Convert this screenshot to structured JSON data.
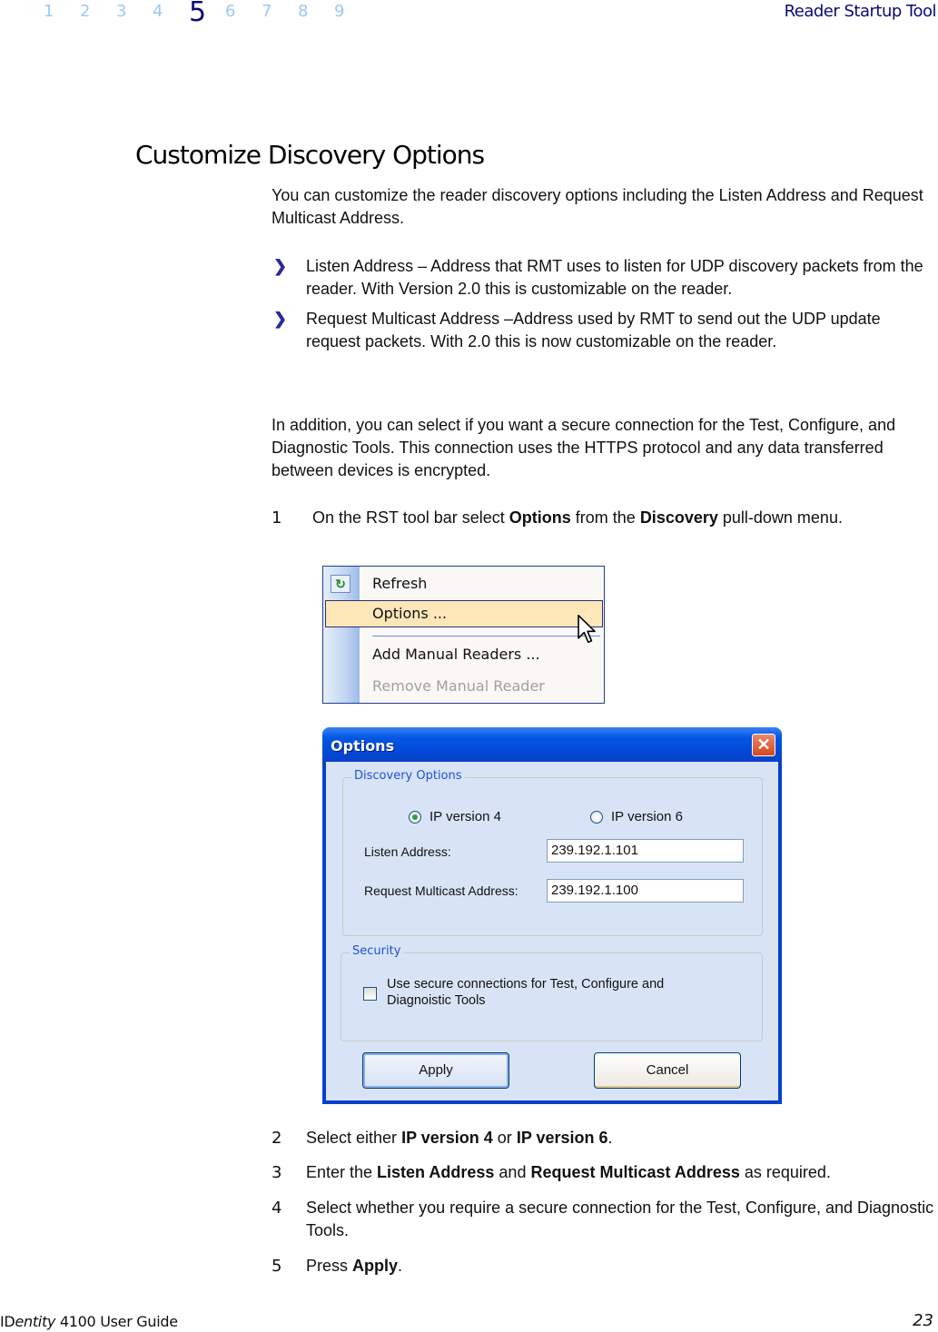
{
  "header": {
    "chapters": [
      "1",
      "2",
      "3",
      "4",
      "5",
      "6",
      "7",
      "8",
      "9"
    ],
    "current_chapter": "5",
    "section_name": "Reader Startup Tool"
  },
  "section_title": "Customize Discovery Options",
  "intro": "You can customize the reader discovery options including the Listen Address and Request Multicast Address.",
  "bullets": [
    "Listen Address – Address that RMT uses to listen for UDP discovery packets from the reader. With Version 2.0 this is customizable on the reader.",
    "Request Multicast Address –Address used by RMT to send out the UDP update request packets. With 2.0 this is now customizable on the reader."
  ],
  "bullet_icon": "chevron-right",
  "paragraph2": "In addition, you can select if you want a secure connection for the Test, Configure, and Diagnostic Tools. This connection uses the HTTPS protocol and any data transferred between devices is encrypted.",
  "steps": [
    {
      "num": "1",
      "parts": [
        "On the RST tool bar select ",
        "Options",
        " from the ",
        "Discovery",
        " pull-down menu."
      ]
    },
    {
      "num": "2",
      "parts": [
        "Select either ",
        "IP version 4",
        " or ",
        "IP version 6",
        "."
      ]
    },
    {
      "num": "3",
      "parts": [
        "Enter the ",
        "Listen Address",
        " and ",
        "Request Multicast Address",
        " as required."
      ]
    },
    {
      "num": "4",
      "parts": [
        "Select whether you require a secure connection for the Test, Configure, and Diagnostic Tools."
      ]
    },
    {
      "num": "5",
      "parts": [
        "Press ",
        "Apply",
        "."
      ]
    }
  ],
  "menu": {
    "items": [
      {
        "label": "Refresh",
        "icon": "refresh-icon",
        "state": "normal"
      },
      {
        "label": "Options ...",
        "state": "highlighted"
      },
      {
        "label": "Add Manual Readers ...",
        "state": "normal"
      },
      {
        "label": "Remove Manual Reader",
        "state": "disabled"
      }
    ],
    "colors": {
      "highlight": "#fde7b8",
      "border": "#1c3f94"
    }
  },
  "dialog": {
    "title": "Options",
    "close_icon": "close-icon",
    "discovery_group": {
      "legend": "Discovery Options",
      "ip_options": [
        {
          "label": "IP version 4",
          "selected": true
        },
        {
          "label": "IP version 6",
          "selected": false
        }
      ],
      "listen_label": "Listen Address:",
      "listen_value": "239.192.1.101",
      "request_label": "Request Multicast Address:",
      "request_value": "239.192.1.100"
    },
    "security_group": {
      "legend": "Security",
      "checkbox_label": "Use secure connections for Test, Configure and Diagnoistic Tools",
      "checked": false
    },
    "apply_label": "Apply",
    "cancel_label": "Cancel",
    "colors": {
      "titlebar": "#0556e4",
      "body": "#d8e4f6",
      "legend": "#1f4fd6"
    }
  },
  "footer": {
    "product_prefix": "ID",
    "product_italic": "entity",
    "product_rest": " 4100 User Guide",
    "page_number": "23"
  }
}
